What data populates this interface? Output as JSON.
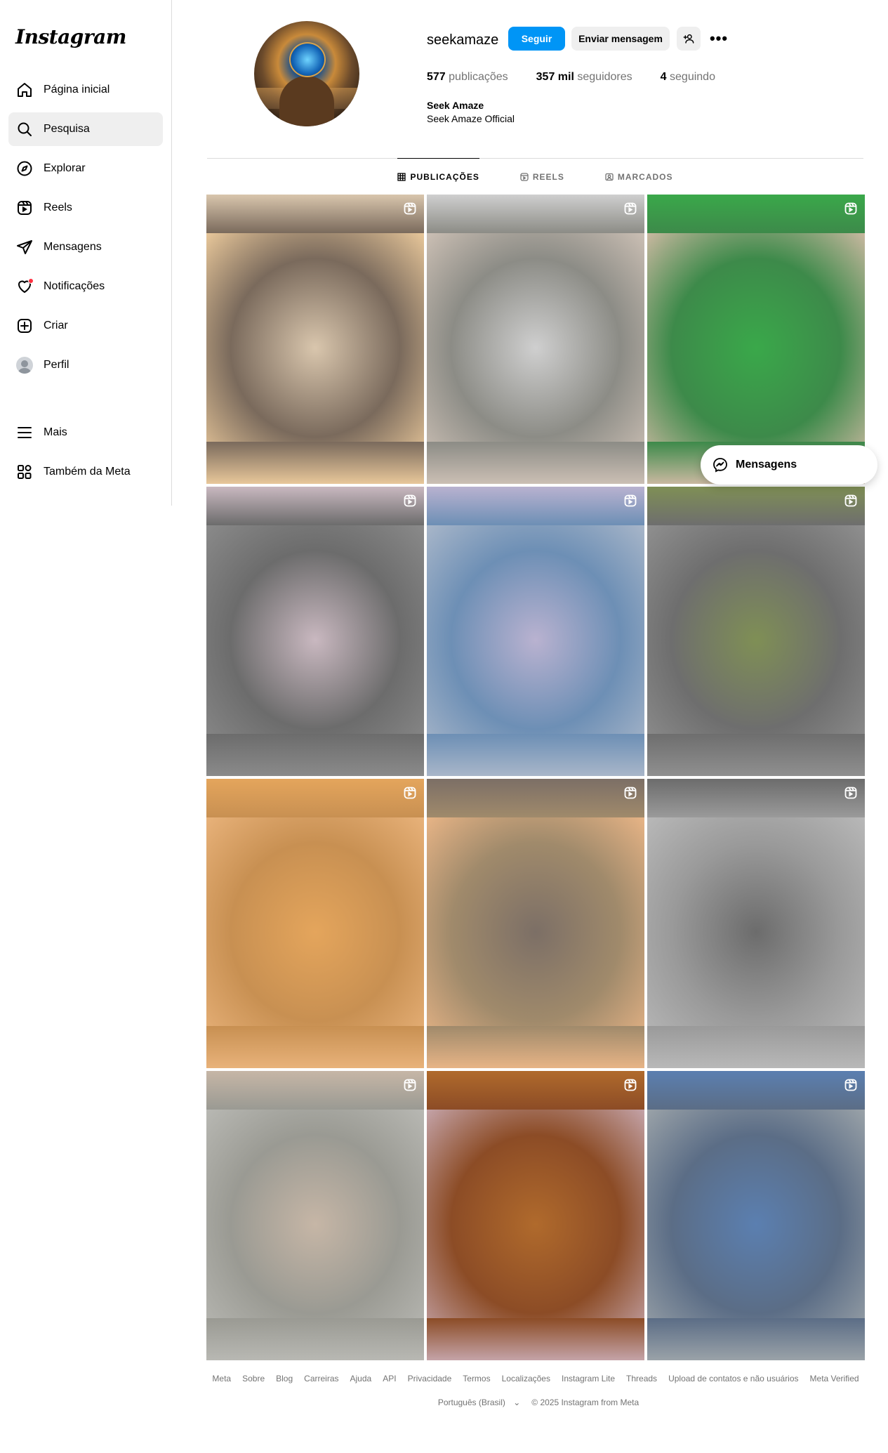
{
  "app": {
    "logo_text": "Instagram"
  },
  "sidebar": {
    "items": [
      {
        "label": "Página inicial",
        "icon": "home-icon"
      },
      {
        "label": "Pesquisa",
        "icon": "search-icon",
        "active": true
      },
      {
        "label": "Explorar",
        "icon": "compass-icon"
      },
      {
        "label": "Reels",
        "icon": "reels-icon"
      },
      {
        "label": "Mensagens",
        "icon": "send-icon"
      },
      {
        "label": "Notificações",
        "icon": "heart-icon",
        "has_dot": true
      },
      {
        "label": "Criar",
        "icon": "plus-square-icon"
      },
      {
        "label": "Perfil",
        "icon": "avatar-icon"
      }
    ],
    "bottom_items": [
      {
        "label": "Mais",
        "icon": "menu-icon"
      },
      {
        "label": "Também da Meta",
        "icon": "meta-apps-icon"
      }
    ]
  },
  "profile": {
    "username": "seekamaze",
    "follow_label": "Seguir",
    "message_label": "Enviar mensagem",
    "stats": {
      "posts_value": "577",
      "posts_label": "publicações",
      "followers_value": "357 mil",
      "followers_label": "seguidores",
      "following_value": "4",
      "following_label": "seguindo"
    },
    "full_name": "Seek Amaze",
    "bio": "Seek Amaze Official"
  },
  "tabs": [
    {
      "label": "PUBLICAÇÕES",
      "active": true
    },
    {
      "label": "REELS",
      "active": false
    },
    {
      "label": "MARCADOS",
      "active": false
    }
  ],
  "grid": {
    "tiles": [
      {
        "name": "saw-cutting-wood-ring",
        "colors": [
          "#d9c6ad",
          "#7a6a5c",
          "#e8c79a"
        ]
      },
      {
        "name": "cutting-log-on-concrete",
        "colors": [
          "#cfcfcf",
          "#8c8c86",
          "#cbbfb4"
        ]
      },
      {
        "name": "building-brick-house",
        "colors": [
          "#3aa84a",
          "#3d8a4a",
          "#c9b8a0"
        ]
      },
      {
        "name": "mixing-cement-bucket",
        "colors": [
          "#c9b8c0",
          "#6c6c6c",
          "#8a8a8a"
        ]
      },
      {
        "name": "water-bottle-pipe",
        "colors": [
          "#b9b2d0",
          "#6d8fb5",
          "#a8b6c9"
        ]
      },
      {
        "name": "tree-stump-table",
        "colors": [
          "#7f8f55",
          "#6e6e6e",
          "#8f8f8f"
        ]
      },
      {
        "name": "gluing-wood-rings",
        "colors": [
          "#e4a55c",
          "#c89052",
          "#e8b27a"
        ]
      },
      {
        "name": "building-wooden-boat",
        "colors": [
          "#7c6f66",
          "#a08a6b",
          "#e7b486"
        ]
      },
      {
        "name": "cutting-plastic-bottle",
        "colors": [
          "#6c6c6c",
          "#9a9a9a",
          "#b8b8b8"
        ]
      },
      {
        "name": "concrete-with-wood",
        "colors": [
          "#c6b6a6",
          "#9a9a93",
          "#b8b8b3"
        ]
      },
      {
        "name": "measuring-cup-seeds",
        "colors": [
          "#b06a2c",
          "#8c4c26",
          "#c4a3a8"
        ]
      },
      {
        "name": "lathe-turning-wood",
        "colors": [
          "#5b7fb0",
          "#5b6d86",
          "#9aa2a8"
        ]
      }
    ]
  },
  "floating": {
    "messages_label": "Mensagens"
  },
  "footer": {
    "links": [
      "Meta",
      "Sobre",
      "Blog",
      "Carreiras",
      "Ajuda",
      "API",
      "Privacidade",
      "Termos",
      "Localizações",
      "Instagram Lite",
      "Threads",
      "Upload de contatos e não usuários",
      "Meta Verified"
    ],
    "language": "Português (Brasil)",
    "copyright": "© 2025 Instagram from Meta"
  }
}
